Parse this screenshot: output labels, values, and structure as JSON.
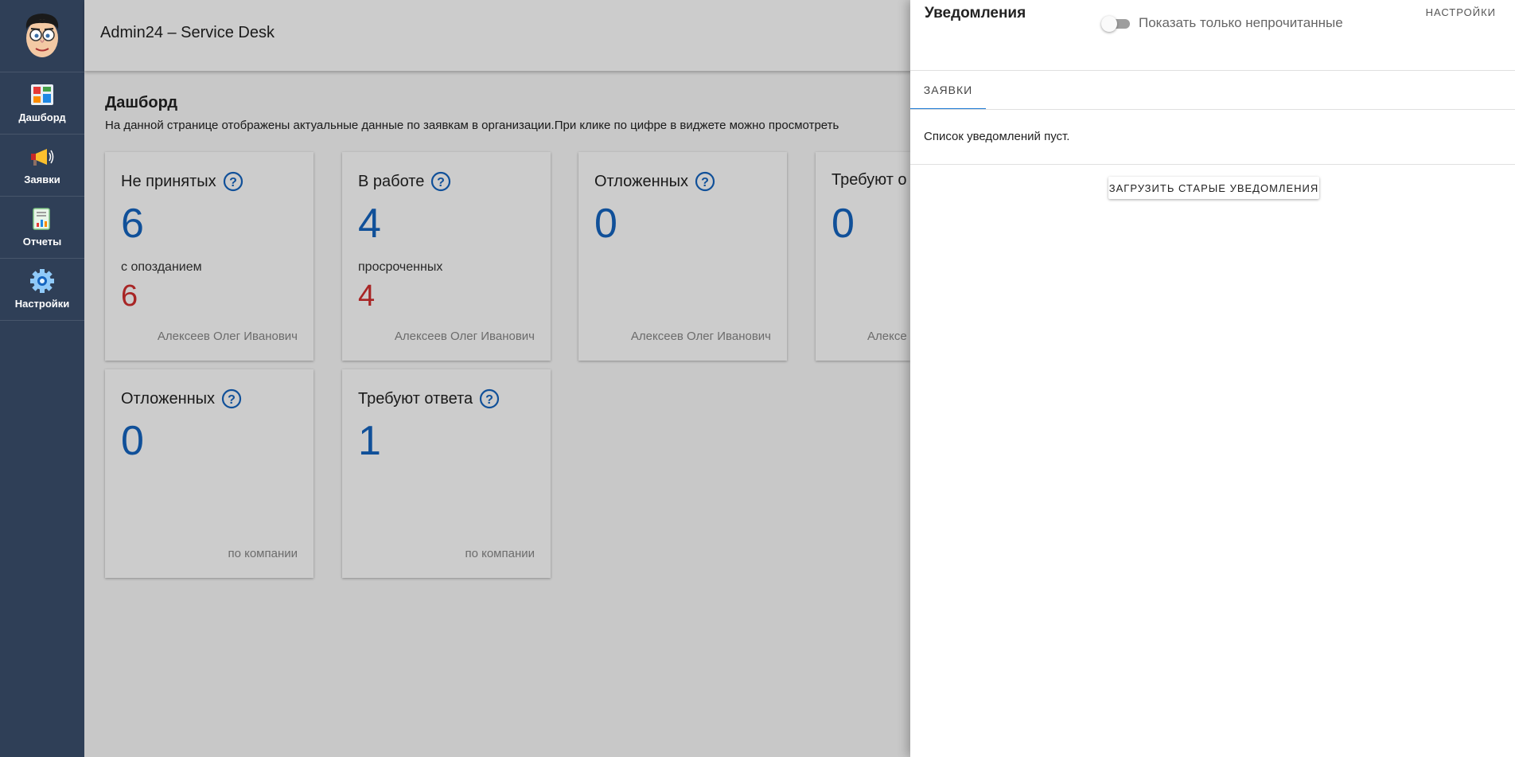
{
  "app": {
    "title": "Admin24 – Service Desk"
  },
  "sidebar": {
    "items": [
      {
        "label": "Дашборд",
        "icon": "dashboard-icon"
      },
      {
        "label": "Заявки",
        "icon": "megaphone-icon"
      },
      {
        "label": "Отчеты",
        "icon": "report-icon"
      },
      {
        "label": "Настройки",
        "icon": "gear-icon"
      }
    ]
  },
  "dashboard": {
    "title": "Дашборд",
    "description": "На данной странице отображены актуальные данные по заявкам в организации.При клике по цифре в виджете можно просмотреть",
    "cards": [
      {
        "title": "Не принятых",
        "value": "6",
        "sub_label": "с опозданием",
        "sub_value": "6",
        "footer": "Алексеев Олег Иванович"
      },
      {
        "title": "В работе",
        "value": "4",
        "sub_label": "просроченных",
        "sub_value": "4",
        "footer": "Алексеев Олег Иванович"
      },
      {
        "title": "Отложенных",
        "value": "0",
        "sub_label": "",
        "sub_value": "",
        "footer": "Алексеев Олег Иванович"
      },
      {
        "title": "Требуют о",
        "value": "0",
        "sub_label": "",
        "sub_value": "",
        "footer": "Алексе"
      },
      {
        "title": "Отложенных",
        "value": "0",
        "sub_label": "",
        "sub_value": "",
        "footer": "по компании"
      },
      {
        "title": "Требуют ответа",
        "value": "1",
        "sub_label": "",
        "sub_value": "",
        "footer": "по компании"
      }
    ]
  },
  "notifications": {
    "title": "Уведомления",
    "toggle_label": "Показать только непрочитанные",
    "toggle_on": false,
    "settings_label": "НАСТРОЙКИ",
    "tab_label": "ЗАЯВКИ",
    "empty_text": "Список уведомлений пуст.",
    "load_button_label": "ЗАГРУЗИТЬ СТАРЫЕ УВЕДОМЛЕНИЯ"
  },
  "colors": {
    "sidebar_bg": "#2f3f57",
    "accent_blue": "#1565c0",
    "alert_red": "#d32f2f"
  }
}
